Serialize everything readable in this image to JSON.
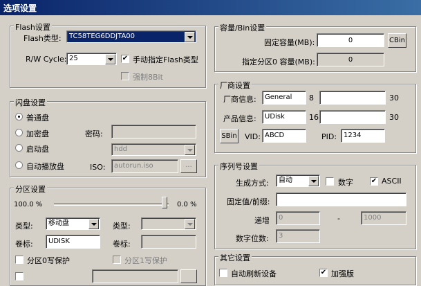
{
  "window": {
    "title": "选项设置"
  },
  "flash_group": {
    "title": "Flash设置",
    "type_label": "Flash类型:",
    "type_value": "TC58TEG6DDJTA00",
    "rw_label": "R/W Cycle:",
    "rw_value": "25",
    "manual_label": "手动指定Flash类型",
    "manual_checked": true,
    "force_label": "强制8Bit",
    "force_checked": false
  },
  "capacity_group": {
    "title": "容量/Bin设置",
    "fixed_label": "固定容量(MB):",
    "fixed_value": "0",
    "cbin_label": "CBin",
    "part0_label": "指定分区0 容量(MB):",
    "part0_value": "0"
  },
  "udisk_group": {
    "title": "闪盘设置",
    "options": [
      "普通盘",
      "加密盘",
      "启动盘",
      "自动播放盘"
    ],
    "selected_option": "普通盘",
    "password_label": "密码:",
    "password_value": "",
    "boot_value": "hdd",
    "iso_label": "ISO:",
    "iso_value": "autorun.iso",
    "iso_browse": "..."
  },
  "vendor_group": {
    "title": "厂商设置",
    "vendor_label": "厂商信息:",
    "vendor_value": "General",
    "vendor_len": "8",
    "vendor_max": "30",
    "product_label": "产品信息:",
    "product_value": "UDisk",
    "product_len": "16",
    "product_max": "30",
    "sbin_label": "SBin",
    "vid_label": "VID:",
    "vid_value": "ABCD",
    "pid_label": "PID:",
    "pid_value": "1234"
  },
  "partition_group": {
    "title": "分区设置",
    "ratio_left": "100.0 %",
    "ratio_right": "0.0 %",
    "slider_position_pct": 100,
    "type0_label": "类型:",
    "type0_value": "移动盘",
    "type1_label": "类型:",
    "type1_value": "",
    "label0_label": "卷标:",
    "label0_value": "UDISK",
    "label1_label": "卷标:",
    "label1_value": "",
    "wp0_label": "分区0写保护",
    "wp1_label": "分区1写保护"
  },
  "serial_group": {
    "title": "序列号设置",
    "mode_label": "生成方式:",
    "mode_value": "自动",
    "digit_label": "数字",
    "digit_checked": false,
    "ascii_label": "ASCII",
    "ascii_checked": true,
    "prefix_label": "固定值/前缀:",
    "prefix_value": "",
    "inc_label": "递增",
    "inc_from": "0",
    "inc_dash": "-",
    "inc_to": "1000",
    "digits_label": "数字位数:",
    "digits_value": "3"
  },
  "other_group": {
    "title": "其它设置",
    "refresh_label": "自动刷新设备",
    "refresh_checked": false,
    "enhanced_label": "加强版",
    "enhanced_checked": true
  },
  "icons": {
    "checkmark": "✔"
  }
}
